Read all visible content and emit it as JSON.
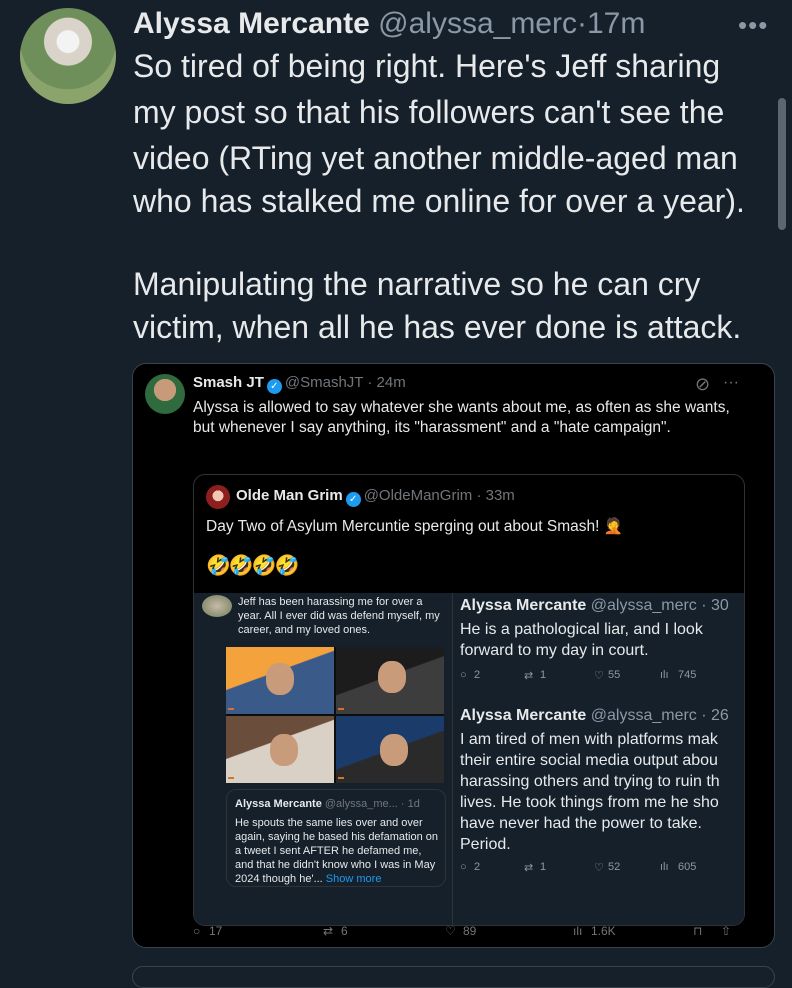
{
  "post": {
    "name": "Alyssa Mercante",
    "handle": "@alyssa_merc",
    "separator": "·",
    "time": "17m",
    "more_icon": "more-icon",
    "lines_p1": [
      "So tired of being right. Here's Jeff sharing",
      "my post so that his followers can't see the",
      "video (RTing yet another middle-aged man",
      "who has stalked me online for over a year)."
    ],
    "lines_p2": [
      "Manipulating the narrative so he can cry",
      "victim, when all he has ever done is attack."
    ]
  },
  "embed": {
    "author": {
      "name": "Smash JT",
      "handle": "@SmashJT",
      "time": "· 24m",
      "text": "Alyssa is allowed to say whatever she wants about me, as often as she wants, but whenever I say anything, its \"harassment\" and a \"hate campaign\"."
    },
    "quote": {
      "name": "Olde Man Grim",
      "handle": "@OldeManGrim",
      "time": "· 33m",
      "text": "Day Two of Asylum Mercuntie sperging out about Smash! 🤦",
      "emoji": "🤣🤣🤣🤣"
    },
    "media": {
      "inner_text": "Jeff has been harassing me for over a year. All I ever did was defend myself, my career, and my loved ones.",
      "inner_quote": {
        "name": "Alyssa Mercante",
        "handle": "@alyssa_me... · 1d",
        "text": "He spouts the same lies over and over again, saying he based his defamation on a tweet I sent AFTER he defamed me, and that he didn't know who I was in May 2024 though he'...",
        "more": "Show more"
      },
      "reply1": {
        "name": "Alyssa Mercante",
        "handle": "@alyssa_merc · 30",
        "text": "He is a pathological liar, and I look forward to my day in court.",
        "replies": "2",
        "reposts": "1",
        "likes": "55",
        "views": "745"
      },
      "reply2": {
        "name": "Alyssa Mercante",
        "handle": "@alyssa_merc · 26",
        "text": "I am tired of men with platforms mak their entire social media output abou harassing others and trying to ruin th lives. He took things from me he sho have never had the power to take. Period.",
        "replies": "2",
        "reposts": "1",
        "likes": "52",
        "views": "605"
      }
    },
    "bar": {
      "replies": "17",
      "reposts": "6",
      "likes": "89",
      "views": "1.6K"
    }
  },
  "colors": {
    "background": "#15202b",
    "accent": "#1d9bf0",
    "muted": "#8b98a5"
  }
}
